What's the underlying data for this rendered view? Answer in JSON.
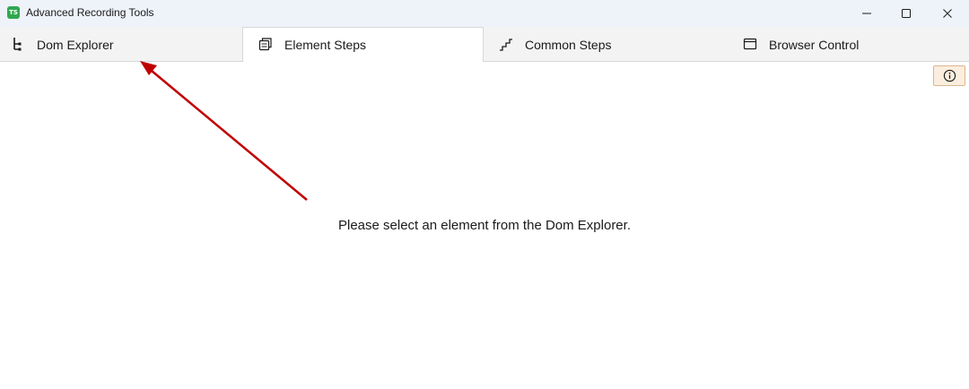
{
  "window": {
    "title": "Advanced Recording Tools",
    "app_icon_text": "TS",
    "icons": [
      "minimize-icon",
      "maximize-icon",
      "close-icon"
    ]
  },
  "tabs": [
    {
      "label": "Dom Explorer",
      "icon": "dom-tree-icon",
      "active": false
    },
    {
      "label": "Element Steps",
      "icon": "stacked-pages-icon",
      "active": true
    },
    {
      "label": "Common Steps",
      "icon": "stairs-icon",
      "active": false
    },
    {
      "label": "Browser Control",
      "icon": "browser-window-icon",
      "active": false
    }
  ],
  "content": {
    "empty_message": "Please select an element from the Dom Explorer.",
    "info_button_icon": "info-icon"
  },
  "annotation": {
    "arrow_color": "#c00000"
  }
}
